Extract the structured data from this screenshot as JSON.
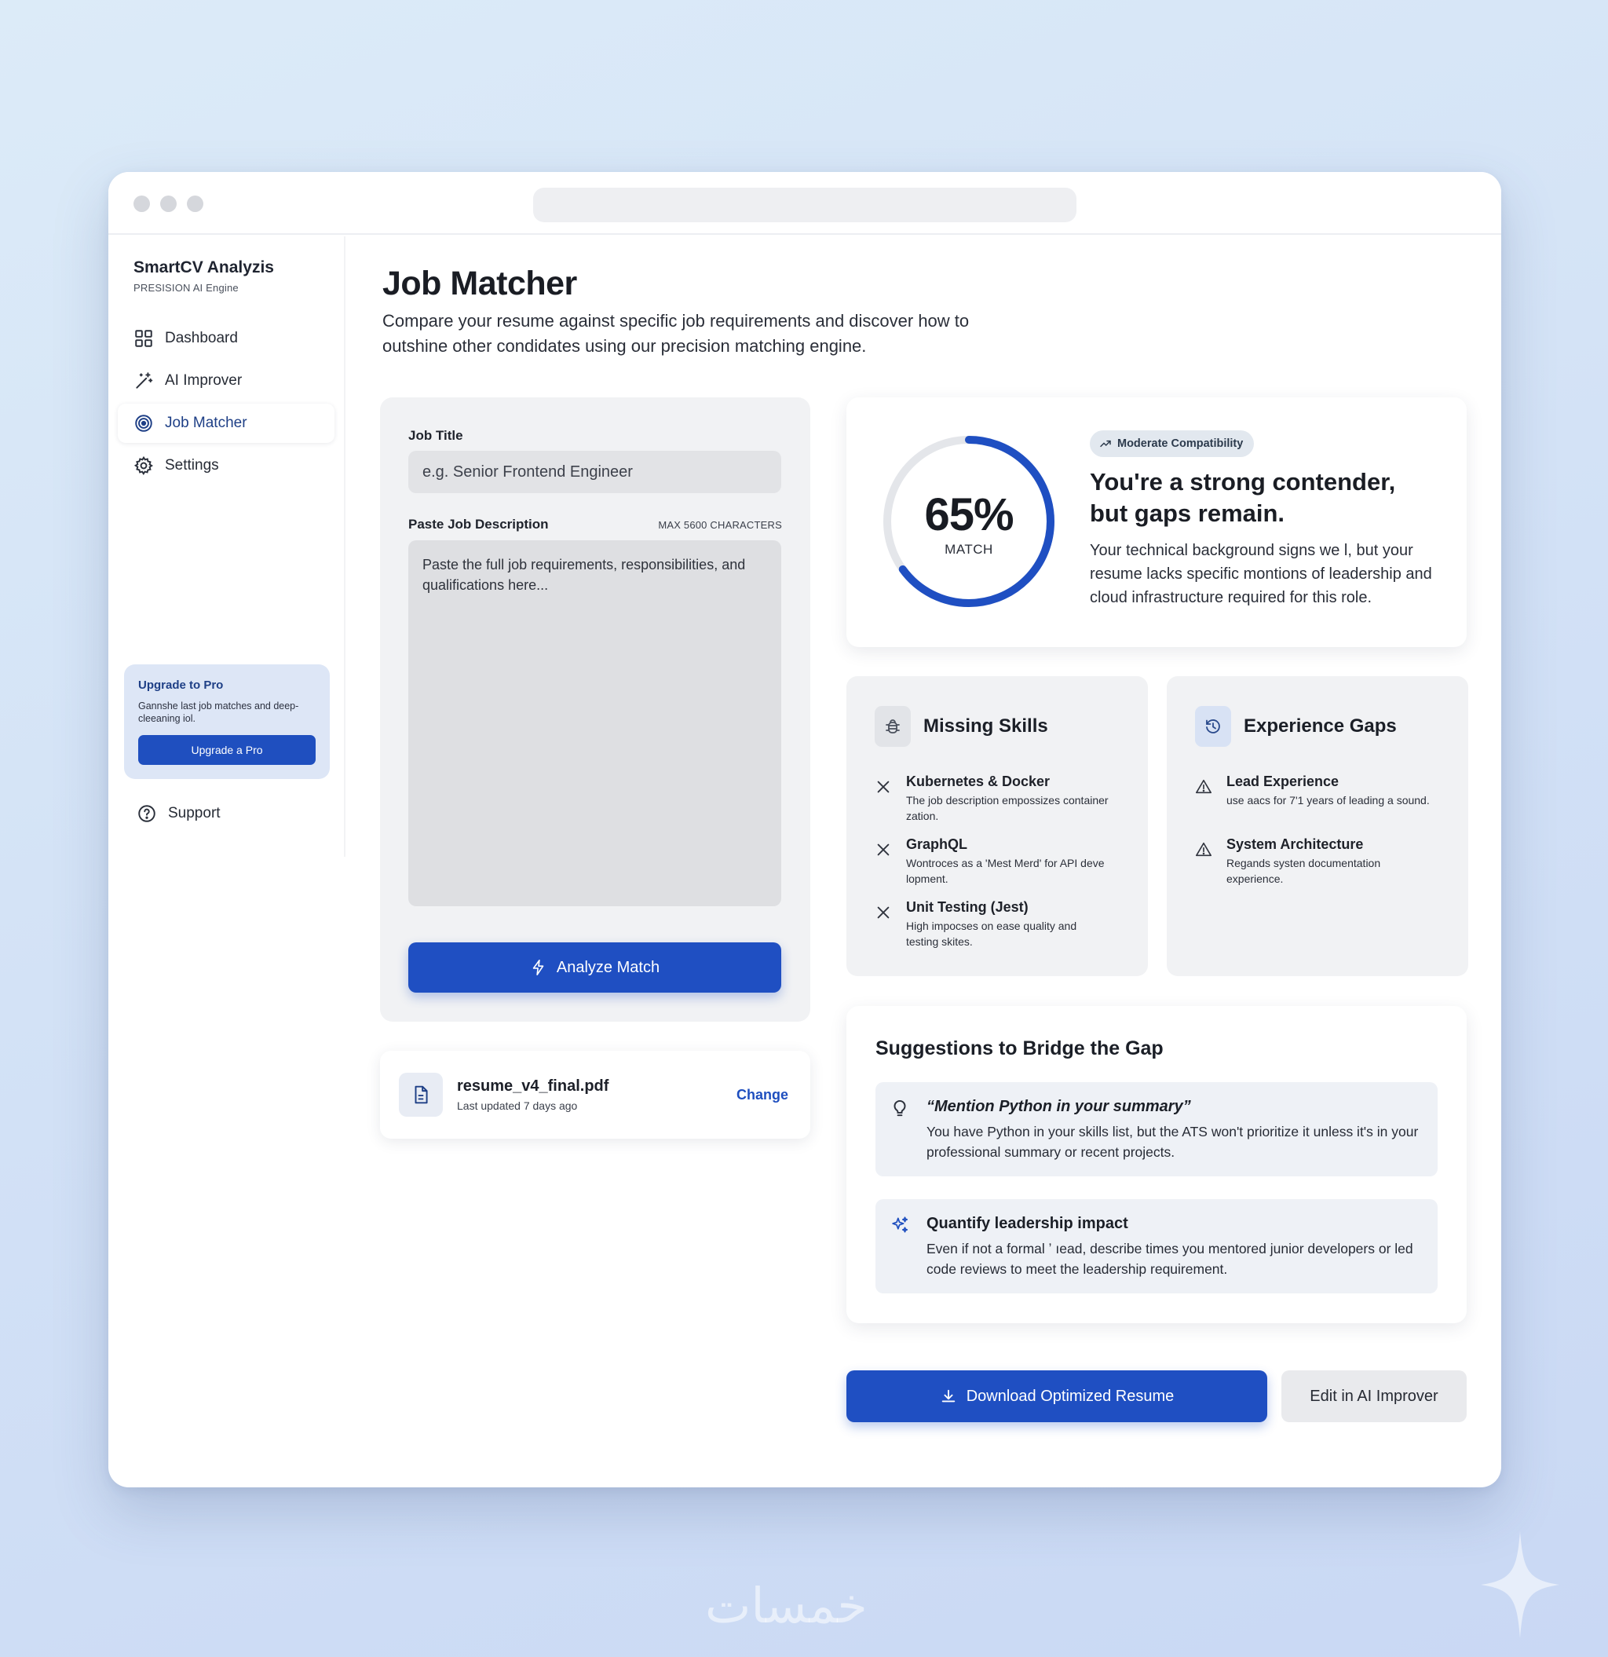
{
  "app": {
    "brand_title": "SmartCV Analyzis",
    "brand_subtitle": "PRESISION AI Engine"
  },
  "sidebar": {
    "items": [
      {
        "label": "Dashboard",
        "icon": "grid-icon"
      },
      {
        "label": "AI Improver",
        "icon": "magic-wand-icon"
      },
      {
        "label": "Job Matcher",
        "icon": "target-icon",
        "active": true
      },
      {
        "label": "Settings",
        "icon": "gear-icon"
      }
    ],
    "upgrade": {
      "title": "Upgrade to Pro",
      "text": "Gannshe last job matches and deep-cleeaning iol.",
      "button": "Upgrade a Pro"
    },
    "support_label": "Support"
  },
  "header": {
    "title": "Job Matcher",
    "description": "Compare your resume against specific job requirements and discover how to outshine other condidates using our precision matching engine."
  },
  "form": {
    "job_title_label": "Job Title",
    "job_title_placeholder": "e.g. Senior Frontend Engineer",
    "job_desc_label": "Paste Job Description",
    "max_chars": "MAX 5600 CHARACTERS",
    "job_desc_placeholder": "Paste the full job requirements, responsibilities, and qualifications here...",
    "analyze_button": "Analyze Match"
  },
  "resume": {
    "file_name": "resume_v4_final.pdf",
    "updated": "Last updated 7 days ago",
    "change_label": "Change"
  },
  "score": {
    "percent_text": "65%",
    "percent_value": 65,
    "label": "MATCH",
    "badge": "Moderate Compatibility",
    "headline": "You're a strong contender, but gaps remain.",
    "body": "Your technical background signs we l, but your resume lacks specific montions of leadership and cloud infrastructure required for this role."
  },
  "missing_skills": {
    "title": "Missing Skills",
    "items": [
      {
        "title": "Kubernetes & Docker",
        "desc": "The job description empossizes container zation."
      },
      {
        "title": "GraphQL",
        "desc": "Wontroces as a 'Mest Merd' for API deve lopment."
      },
      {
        "title": "Unit Testing (Jest)",
        "desc": "High impocses on ease quality and testing skites."
      }
    ]
  },
  "experience_gaps": {
    "title": "Experience Gaps",
    "items": [
      {
        "title": "Lead Experience",
        "desc": "use aacs for 7'1 years of leading a sound."
      },
      {
        "title": "System Architecture",
        "desc": "Regands systen documentation experience."
      }
    ]
  },
  "suggestions": {
    "title": "Suggestions to Bridge the Gap",
    "items": [
      {
        "icon": "lightbulb-icon",
        "title": "“Mention Python in your summary”",
        "body": "You have Python in your skills list, but the ATS won't prioritize it unless it's in your professional summary or recent projects."
      },
      {
        "icon": "sparkles-icon",
        "title": "Quantify leadership impact",
        "body": "Even if not a formal ʼ ıead, describe times you mentored junior developers or led code reviews to meet the leadership requirement."
      }
    ]
  },
  "actions": {
    "download": "Download Optimized Resume",
    "edit": "Edit in AI Improver"
  },
  "colors": {
    "accent": "#1f4fc2",
    "active_nav": "#1e3f86",
    "gauge_track": "#e4e6ea"
  },
  "watermark": "خمسات"
}
